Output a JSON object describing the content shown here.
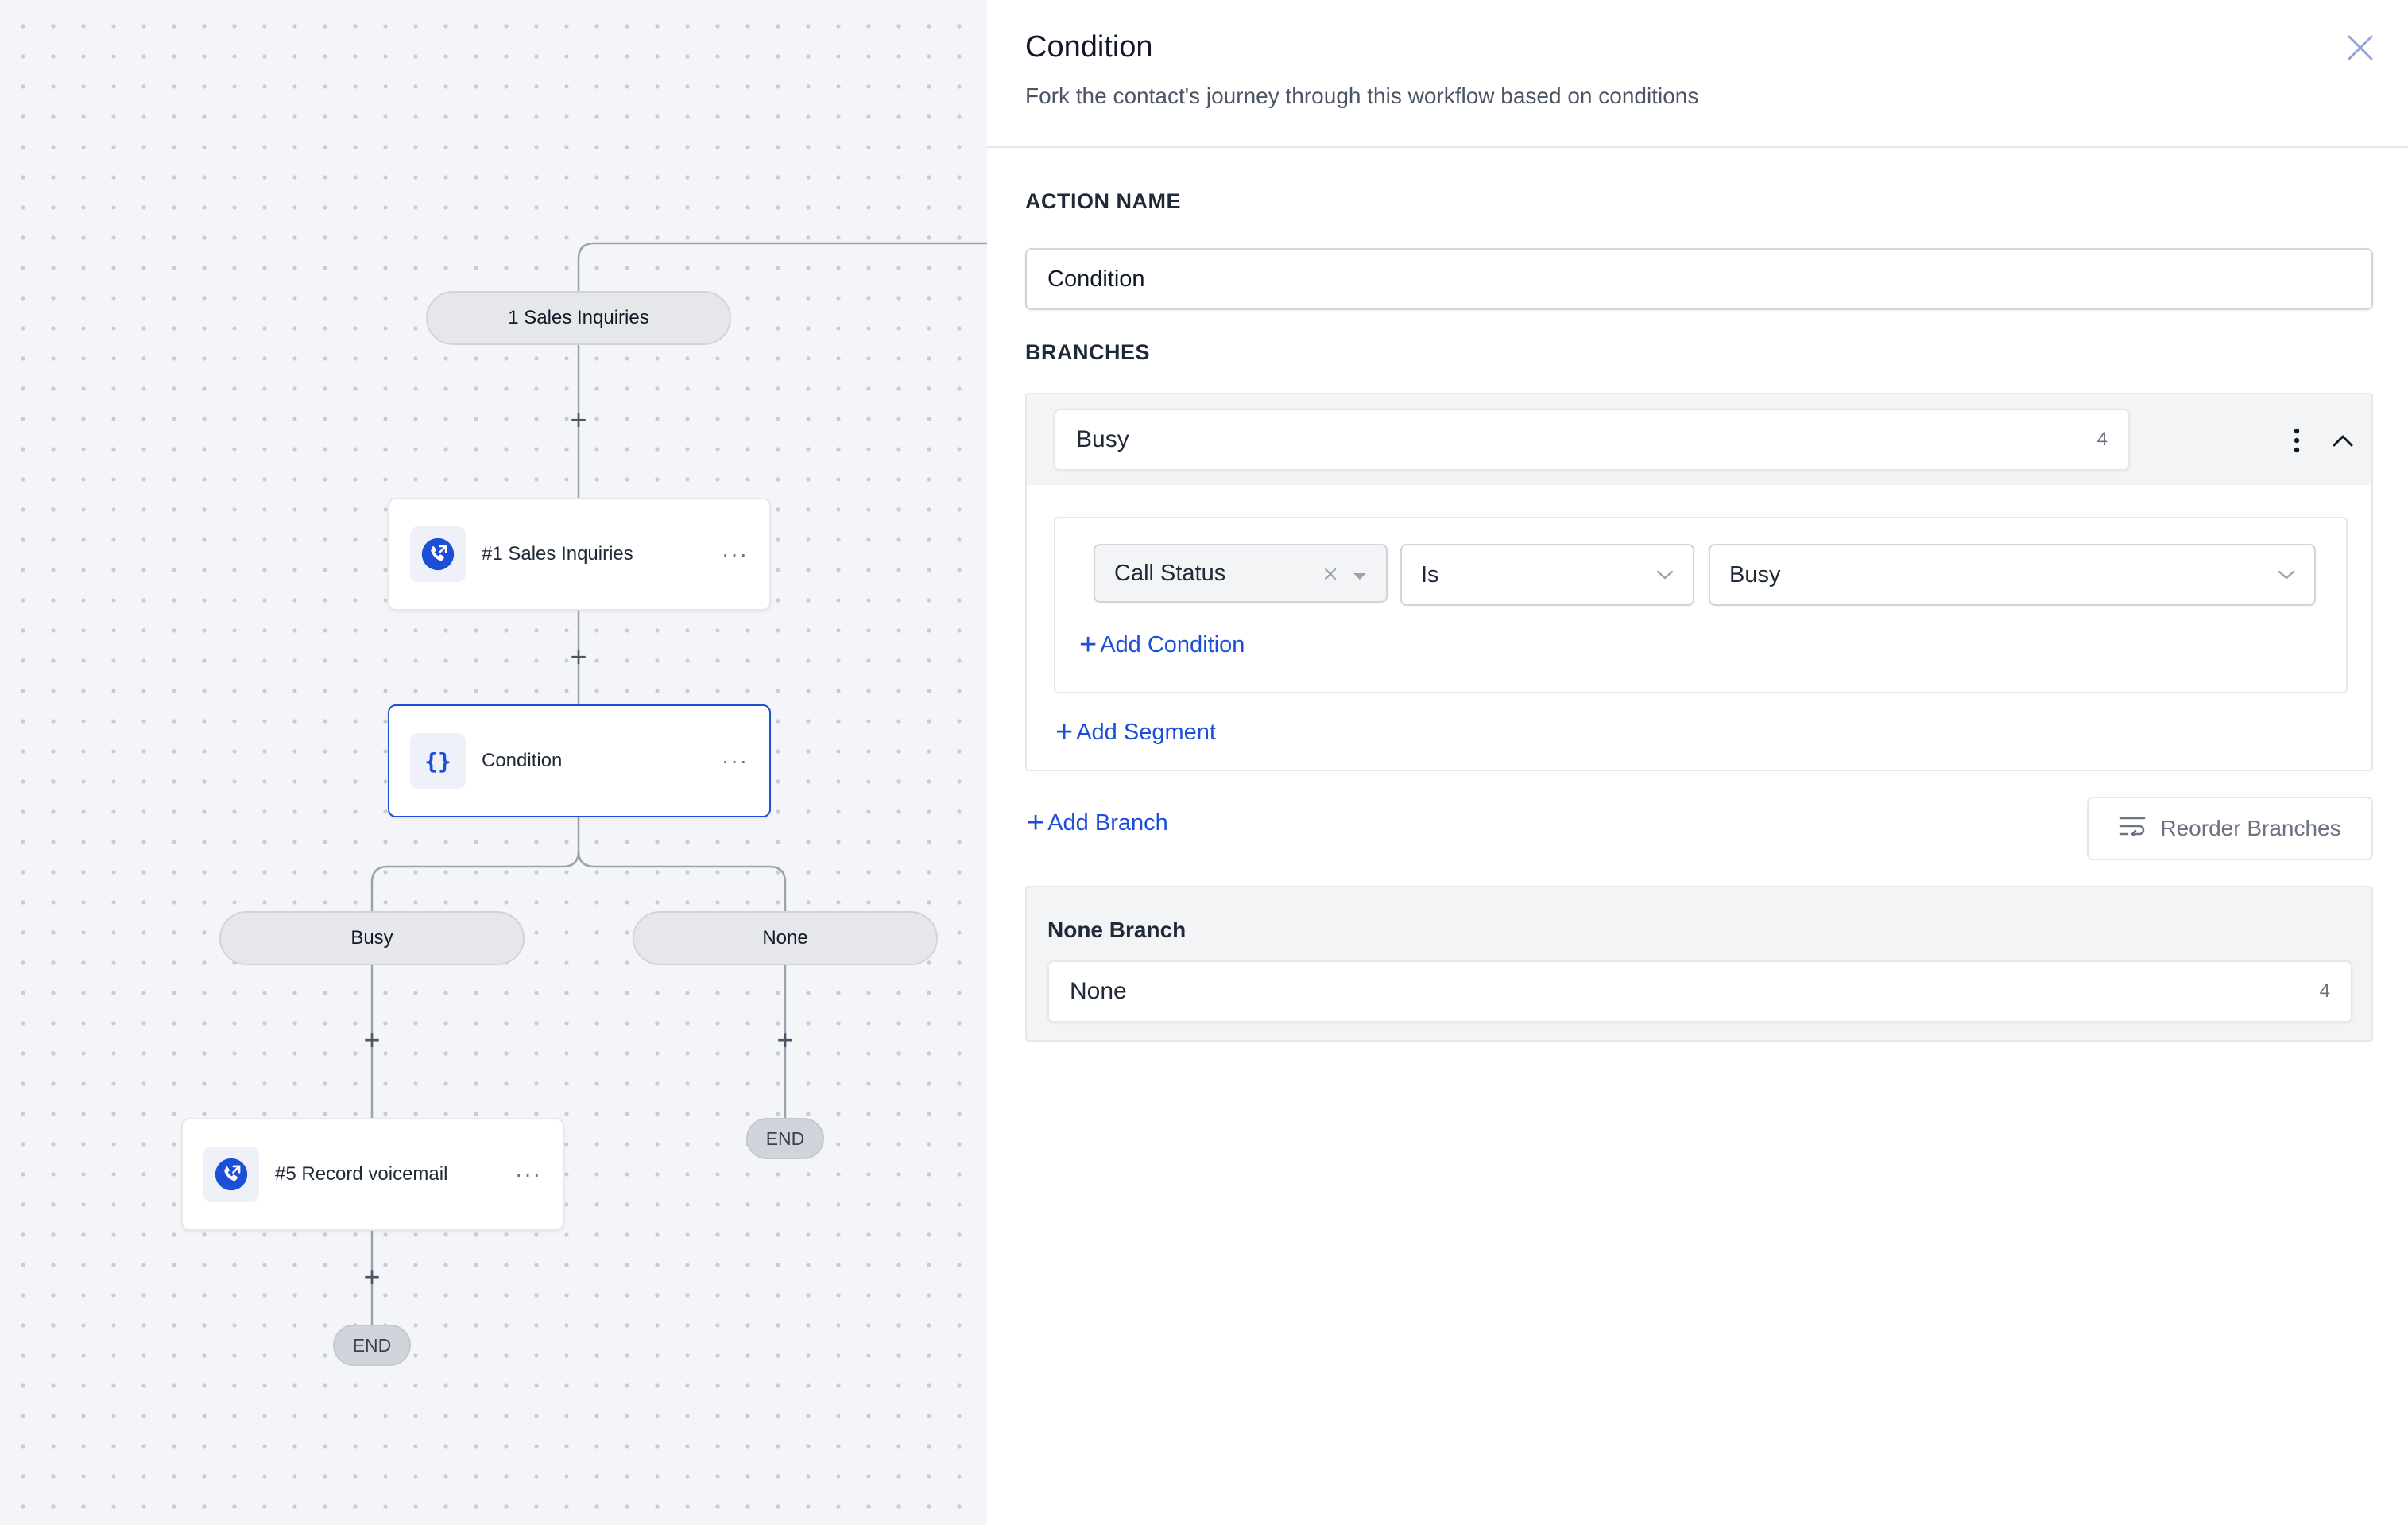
{
  "canvas": {
    "trigger_pill": "1 Sales Inquiries",
    "nodes": [
      {
        "label": "#1 Sales Inquiries",
        "icon": "phone-call-icon",
        "menu": "···"
      },
      {
        "label": "Condition",
        "icon": "braces-icon",
        "icon_text": "{}",
        "menu": "···"
      },
      {
        "label": "#5 Record voicemail",
        "icon": "phone-call-icon",
        "menu": "···"
      }
    ],
    "branch_pills": [
      "Busy",
      "None"
    ],
    "end_label": "END",
    "plus_symbol": "+"
  },
  "panel": {
    "title": "Condition",
    "subtitle": "Fork the contact's journey through this workflow based on conditions",
    "action_name_label": "ACTION NAME",
    "action_name_value": "Condition",
    "branches_label": "BRANCHES",
    "branch": {
      "name": "Busy",
      "count": "4",
      "condition": {
        "field": "Call Status",
        "operator": "Is",
        "value": "Busy"
      },
      "add_condition": "Add Condition",
      "add_segment": "Add Segment"
    },
    "add_branch": "Add Branch",
    "reorder_branches": "Reorder Branches",
    "none_branch": {
      "title": "None Branch",
      "name": "None",
      "count": "4"
    }
  },
  "colors": {
    "accent": "#1d4ed8",
    "canvas_bg": "#f4f5f8",
    "border": "#e5e7eb"
  }
}
